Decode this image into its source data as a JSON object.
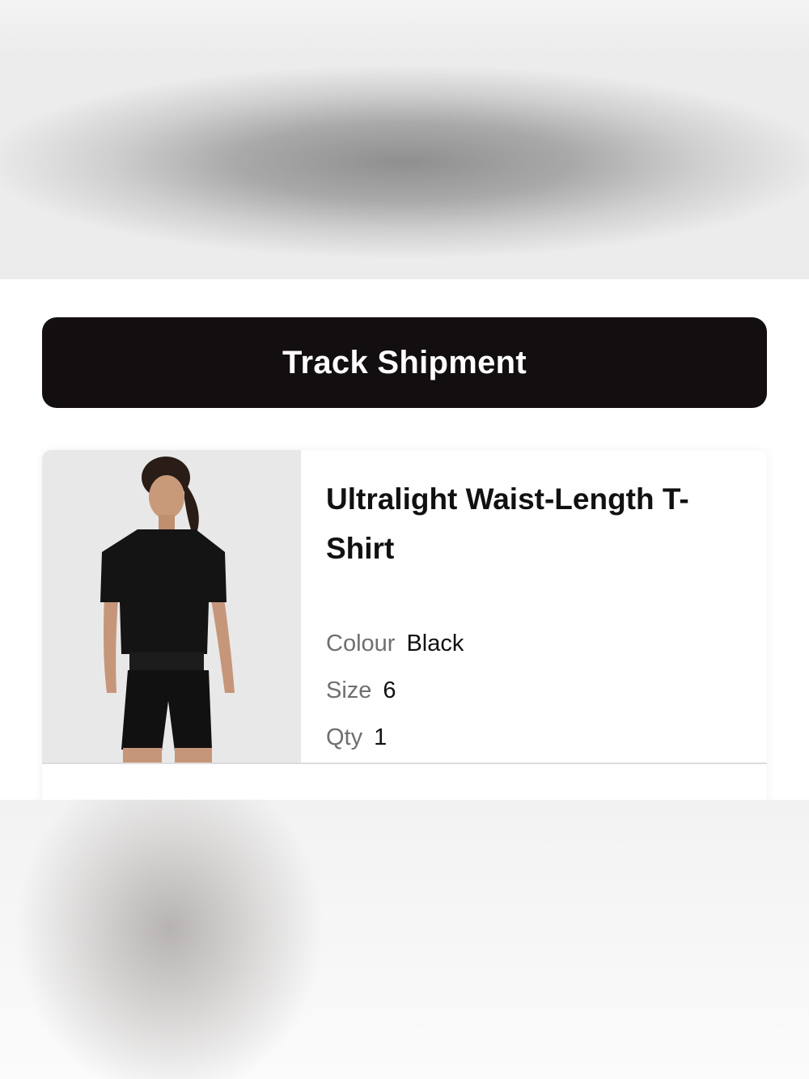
{
  "track_button": {
    "label": "Track Shipment"
  },
  "item": {
    "title": "Ultralight Waist-Length T-Shirt",
    "image_alt": "Model wearing black t-shirt and black shorts",
    "attributes": {
      "colour_label": "Colour",
      "colour_value": "Black",
      "size_label": "Size",
      "size_value": "6",
      "qty_label": "Qty",
      "qty_value": "1"
    }
  },
  "colors": {
    "button_bg": "#130e0f",
    "button_text": "#ffffff",
    "label_gray": "#6f6f6f",
    "text_dark": "#111111"
  }
}
